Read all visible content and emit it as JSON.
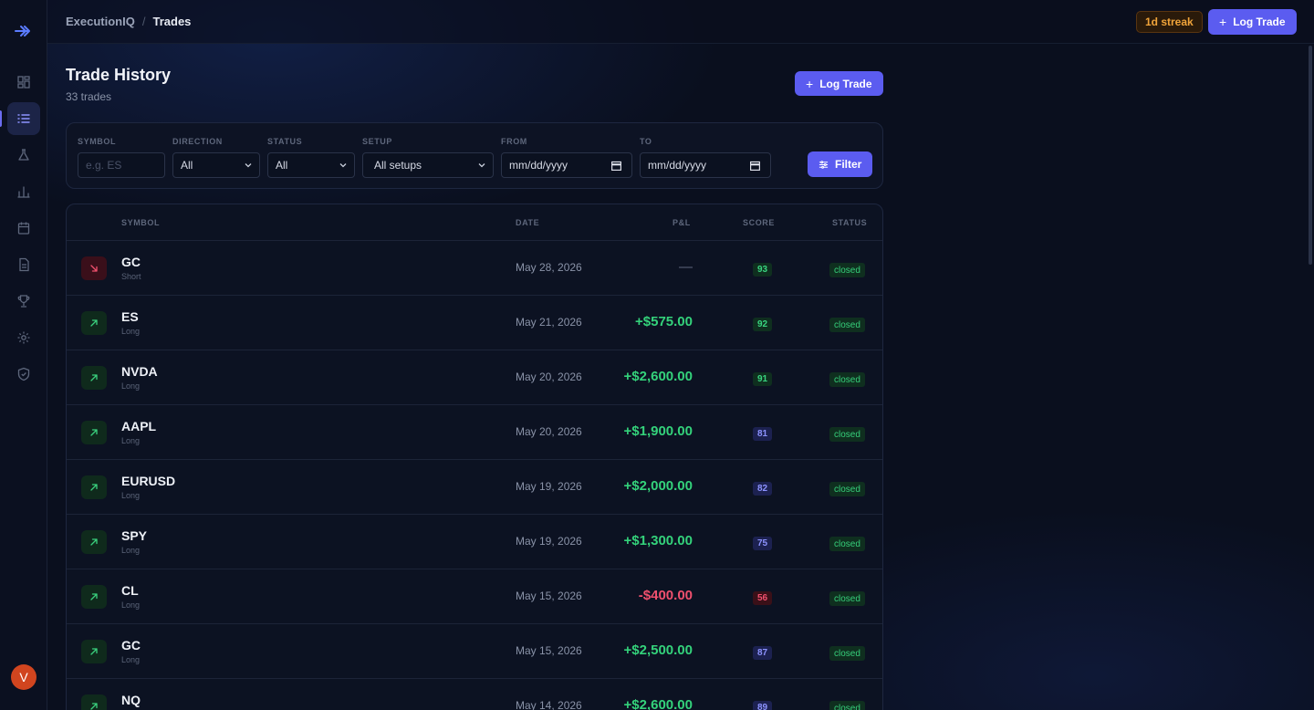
{
  "app": {
    "name": "ExecutionIQ",
    "page": "Trades",
    "streak": "1d streak",
    "log_trade": "Log Trade"
  },
  "colors": {
    "accent": "#5b5cf0",
    "positive": "#34d27b",
    "negative": "#f0506e",
    "streak": "#f0a43a"
  },
  "sidebar": {
    "items": [
      {
        "name": "dashboard-icon"
      },
      {
        "name": "trades-list-icon",
        "active": true
      },
      {
        "name": "lab-flask-icon"
      },
      {
        "name": "analytics-bar-chart-icon"
      },
      {
        "name": "calendar-icon"
      },
      {
        "name": "journal-document-icon"
      },
      {
        "name": "trophy-icon"
      },
      {
        "name": "settings-gear-icon"
      },
      {
        "name": "shield-icon"
      }
    ],
    "avatar_initial": "V"
  },
  "page": {
    "title": "Trade History",
    "subtitle": "33 trades",
    "log_trade": "Log Trade"
  },
  "filters": {
    "symbol": {
      "label": "SYMBOL",
      "placeholder": "e.g. ES"
    },
    "direction": {
      "label": "DIRECTION",
      "value": "All"
    },
    "status": {
      "label": "STATUS",
      "value": "All"
    },
    "setup": {
      "label": "SETUP",
      "value": "All setups"
    },
    "from": {
      "label": "FROM",
      "value": "mm/dd/yyyy"
    },
    "to": {
      "label": "TO",
      "value": "mm/dd/yyyy"
    },
    "filter_button": "Filter"
  },
  "table": {
    "headers": {
      "symbol": "SYMBOL",
      "date": "DATE",
      "pnl": "P&L",
      "score": "SCORE",
      "status": "STATUS"
    },
    "rows": [
      {
        "symbol": "GC",
        "side": "Short",
        "direction": "short",
        "date": "May 28, 2026",
        "pnl": "—",
        "pnl_kind": "none",
        "score": "93",
        "score_kind": "green",
        "status": "closed"
      },
      {
        "symbol": "ES",
        "side": "Long",
        "direction": "long",
        "date": "May 21, 2026",
        "pnl": "+$575.00",
        "pnl_kind": "pos",
        "score": "92",
        "score_kind": "green",
        "status": "closed"
      },
      {
        "symbol": "NVDA",
        "side": "Long",
        "direction": "long",
        "date": "May 20, 2026",
        "pnl": "+$2,600.00",
        "pnl_kind": "pos",
        "score": "91",
        "score_kind": "green",
        "status": "closed"
      },
      {
        "symbol": "AAPL",
        "side": "Long",
        "direction": "long",
        "date": "May 20, 2026",
        "pnl": "+$1,900.00",
        "pnl_kind": "pos",
        "score": "81",
        "score_kind": "blue",
        "status": "closed"
      },
      {
        "symbol": "EURUSD",
        "side": "Long",
        "direction": "long",
        "date": "May 19, 2026",
        "pnl": "+$2,000.00",
        "pnl_kind": "pos",
        "score": "82",
        "score_kind": "blue",
        "status": "closed"
      },
      {
        "symbol": "SPY",
        "side": "Long",
        "direction": "long",
        "date": "May 19, 2026",
        "pnl": "+$1,300.00",
        "pnl_kind": "pos",
        "score": "75",
        "score_kind": "blue",
        "status": "closed"
      },
      {
        "symbol": "CL",
        "side": "Long",
        "direction": "long",
        "date": "May 15, 2026",
        "pnl": "-$400.00",
        "pnl_kind": "neg",
        "score": "56",
        "score_kind": "red",
        "status": "closed"
      },
      {
        "symbol": "GC",
        "side": "Long",
        "direction": "long",
        "date": "May 15, 2026",
        "pnl": "+$2,500.00",
        "pnl_kind": "pos",
        "score": "87",
        "score_kind": "blue",
        "status": "closed"
      },
      {
        "symbol": "NQ",
        "side": "Long",
        "direction": "long",
        "date": "May 14, 2026",
        "pnl": "+$2,600.00",
        "pnl_kind": "pos",
        "score": "89",
        "score_kind": "blue",
        "status": "closed"
      }
    ]
  }
}
